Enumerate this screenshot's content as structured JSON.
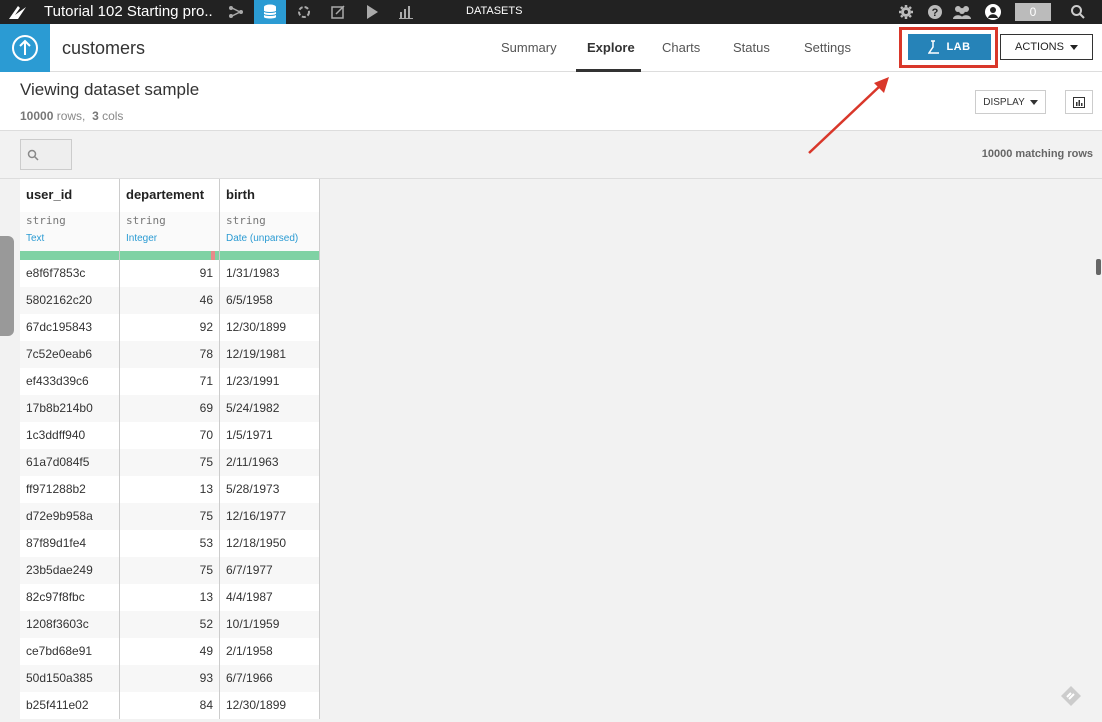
{
  "topbar": {
    "project_title": "Tutorial 102 Starting pro...",
    "section_label": "DATASETS",
    "counter": "0",
    "nav_icons": [
      "flow-icon",
      "datasets-icon",
      "recipes-icon",
      "notebooks-icon",
      "jobs-icon",
      "dashboards-icon"
    ],
    "right_icons": [
      "gear-icon",
      "help-icon",
      "users-icon",
      "avatar",
      "search-icon"
    ]
  },
  "header": {
    "dataset_name": "customers",
    "tabs": [
      {
        "label": "Summary"
      },
      {
        "label": "Explore"
      },
      {
        "label": "Charts"
      },
      {
        "label": "Status"
      },
      {
        "label": "Settings"
      }
    ],
    "lab_label": "LAB",
    "actions_label": "ACTIONS"
  },
  "viewing": {
    "title": "Viewing dataset sample",
    "rows_count": "10000",
    "rows_word": "rows,",
    "cols_count": "3",
    "cols_word": "cols",
    "display_label": "DISPLAY"
  },
  "search": {
    "matching": "10000 matching rows"
  },
  "columns": [
    {
      "name": "user_id",
      "storage": "string",
      "meaning": "Text"
    },
    {
      "name": "departement",
      "storage": "string",
      "meaning": "Integer"
    },
    {
      "name": "birth",
      "storage": "string",
      "meaning": "Date (unparsed)"
    }
  ],
  "rows": [
    [
      "e8f6f7853c",
      "91",
      "1/31/1983"
    ],
    [
      "5802162c20",
      "46",
      "6/5/1958"
    ],
    [
      "67dc195843",
      "92",
      "12/30/1899"
    ],
    [
      "7c52e0eab6",
      "78",
      "12/19/1981"
    ],
    [
      "ef433d39c6",
      "71",
      "1/23/1991"
    ],
    [
      "17b8b214b0",
      "69",
      "5/24/1982"
    ],
    [
      "1c3ddff940",
      "70",
      "1/5/1971"
    ],
    [
      "61a7d084f5",
      "75",
      "2/11/1963"
    ],
    [
      "ff971288b2",
      "13",
      "5/28/1973"
    ],
    [
      "d72e9b958a",
      "75",
      "12/16/1977"
    ],
    [
      "87f89d1fe4",
      "53",
      "12/18/1950"
    ],
    [
      "23b5dae249",
      "75",
      "6/7/1977"
    ],
    [
      "82c97f8fbc",
      "13",
      "4/4/1987"
    ],
    [
      "1208f3603c",
      "52",
      "10/1/1959"
    ],
    [
      "ce7bd68e91",
      "49",
      "2/1/1958"
    ],
    [
      "50d150a385",
      "93",
      "6/7/1966"
    ],
    [
      "b25f411e02",
      "84",
      "12/30/1899"
    ]
  ],
  "colors": {
    "accent": "#2b9bd3",
    "lab_button": "#2683b8",
    "highlight_box": "#d9372a",
    "quality_ok": "#7fd2a4",
    "quality_bad": "#e88a8a"
  }
}
